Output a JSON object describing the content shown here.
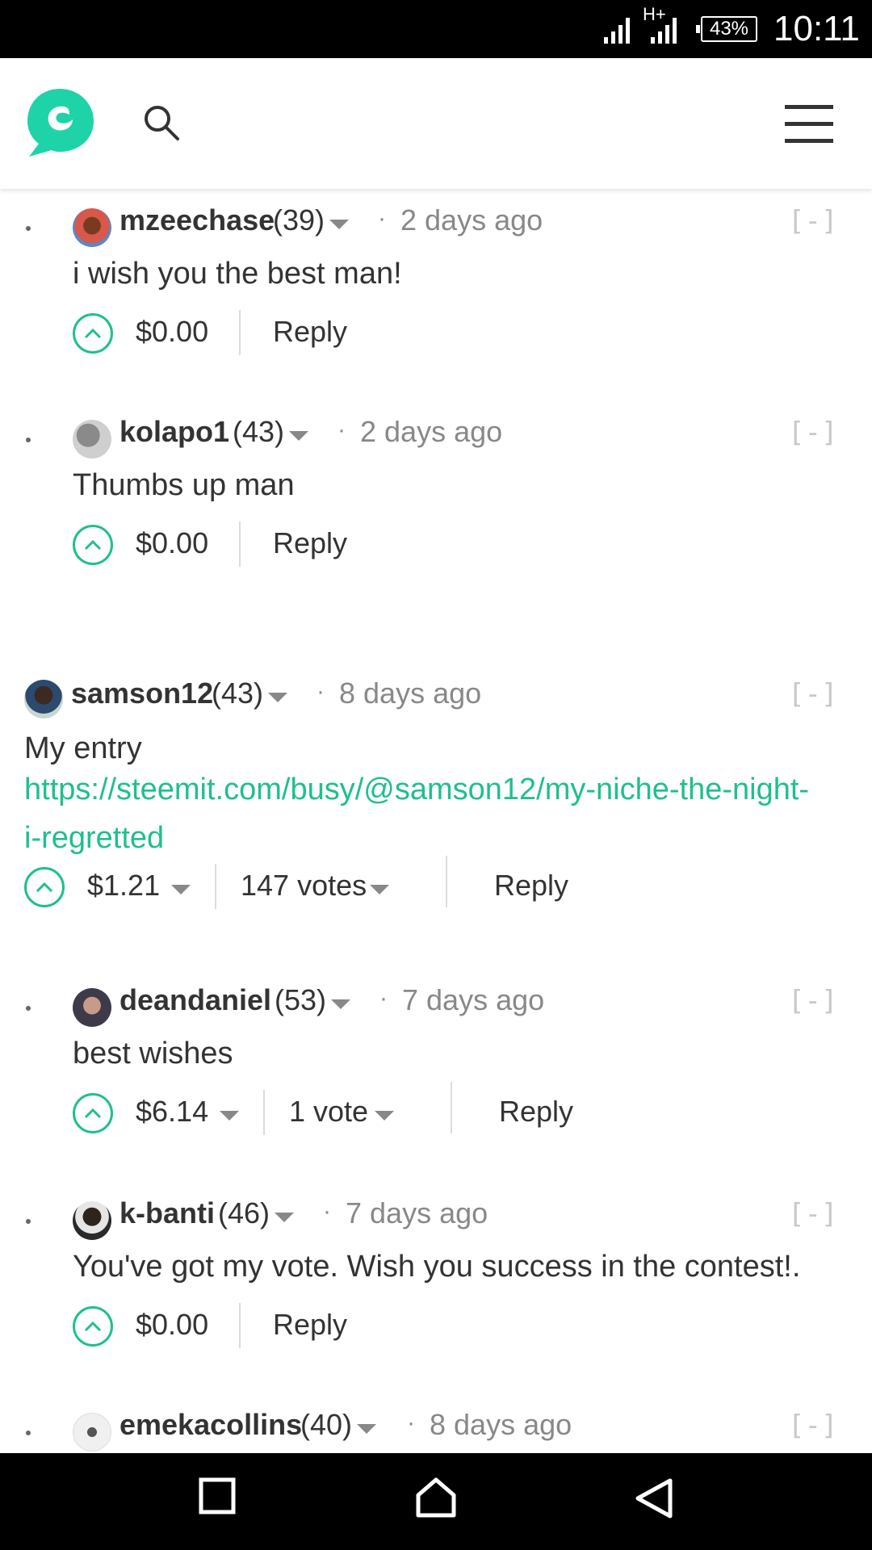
{
  "status_bar": {
    "network": "H+",
    "battery": "43%",
    "time": "10:11"
  },
  "header": {
    "logo_icon": "steemit-logo-icon",
    "search_icon": "search-icon",
    "menu_icon": "hamburger-menu-icon",
    "brand_color": "#1fbf8f"
  },
  "comments": [
    {
      "author": "mzeechase",
      "reputation": "(39)",
      "time": "2 days ago",
      "collapse": "[-]",
      "body": "i wish you the best man!",
      "payout": "$0.00",
      "reply": "Reply"
    },
    {
      "author": "kolapo1",
      "reputation": "(43)",
      "time": "2 days ago",
      "collapse": "[-]",
      "body": "Thumbs up man",
      "payout": "$0.00",
      "reply": "Reply"
    },
    {
      "author": "samson12",
      "reputation": "(43)",
      "time": "8 days ago",
      "collapse": "[-]",
      "body": "My entry",
      "link": "https://steemit.com/busy/@samson12/my-niche-the-night-i-regretted",
      "payout": "$1.21",
      "votes": "147 votes",
      "reply": "Reply"
    },
    {
      "author": "deandaniel",
      "reputation": "(53)",
      "time": "7 days ago",
      "collapse": "[-]",
      "body": "best wishes",
      "payout": "$6.14",
      "votes": "1 vote",
      "reply": "Reply"
    },
    {
      "author": "k-banti",
      "reputation": "(46)",
      "time": "7 days ago",
      "collapse": "[-]",
      "body": "You've got my vote. Wish you success in the contest!.",
      "payout": "$0.00",
      "reply": "Reply"
    },
    {
      "author": "emekacollins",
      "reputation": "(40)",
      "time": "8 days ago",
      "collapse": "[-]"
    }
  ],
  "nav_bar": {
    "recents_icon": "recents-square-icon",
    "home_icon": "home-icon",
    "back_icon": "back-triangle-icon"
  }
}
